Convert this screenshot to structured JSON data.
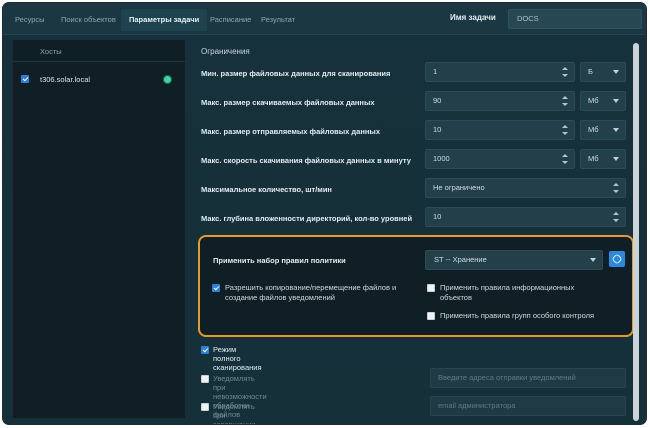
{
  "tabs": [
    {
      "label": "Ресурсы"
    },
    {
      "label": "Поиск объектов"
    },
    {
      "label": "Параметры задачи"
    },
    {
      "label": "Расписание"
    },
    {
      "label": "Результат"
    }
  ],
  "task": {
    "name_label": "Имя задачи",
    "name_value": "DOCS"
  },
  "hosts": {
    "title": "Хосты",
    "items": [
      {
        "name": "t306.solar.local",
        "checked": true,
        "status_color": "#3ad7a2"
      }
    ]
  },
  "restrictions": {
    "title": "Ограничения",
    "rows": [
      {
        "label": "Мин. размер файловых данных для сканирования",
        "value": "1",
        "unit": "Б"
      },
      {
        "label": "Макс. размер скачиваемых файловых данных",
        "value": "90",
        "unit": "Мб"
      },
      {
        "label": "Макс. размер отправляемых файловых данных",
        "value": "10",
        "unit": "Мб"
      },
      {
        "label": "Макс. скорость скачивания файловых данных в минуту",
        "value": "1000",
        "unit": "Мб"
      },
      {
        "label": "Максимальное количество, шт/мин",
        "value": "Не ограничено"
      },
      {
        "label": "Макс. глубина вложенности директорий, кол-во уровней",
        "value": "10"
      }
    ]
  },
  "policy": {
    "label": "Применить набор правил политики",
    "selected": "ST -- Хранение",
    "allow_copy": {
      "text_line1": "Разрешить копирование/перемещение файлов и",
      "text_line2": "создание файлов уведомлений",
      "checked": true
    },
    "apply_info_rules": {
      "text_line1": "Применить правила информационных",
      "text_line2": "объектов",
      "checked": false
    },
    "apply_group_rules": {
      "text": "Применить правила групп особого контроля",
      "checked": false
    }
  },
  "full_scan": {
    "label": "Режим полного сканирования",
    "checked": true
  },
  "notify_fail": {
    "label": "Уведомлять при невозможности обработки файлов",
    "placeholder": "Введите адреса отправки уведомлений",
    "checked": false
  },
  "notify_errors": {
    "label": "Уведомлять при завершении задачи с ошибками",
    "placeholder": "email администратора",
    "checked": false
  },
  "colors": {
    "accent": "#2d7fd9",
    "highlight": "#e79a2a",
    "status_ok": "#3ad7a2"
  }
}
